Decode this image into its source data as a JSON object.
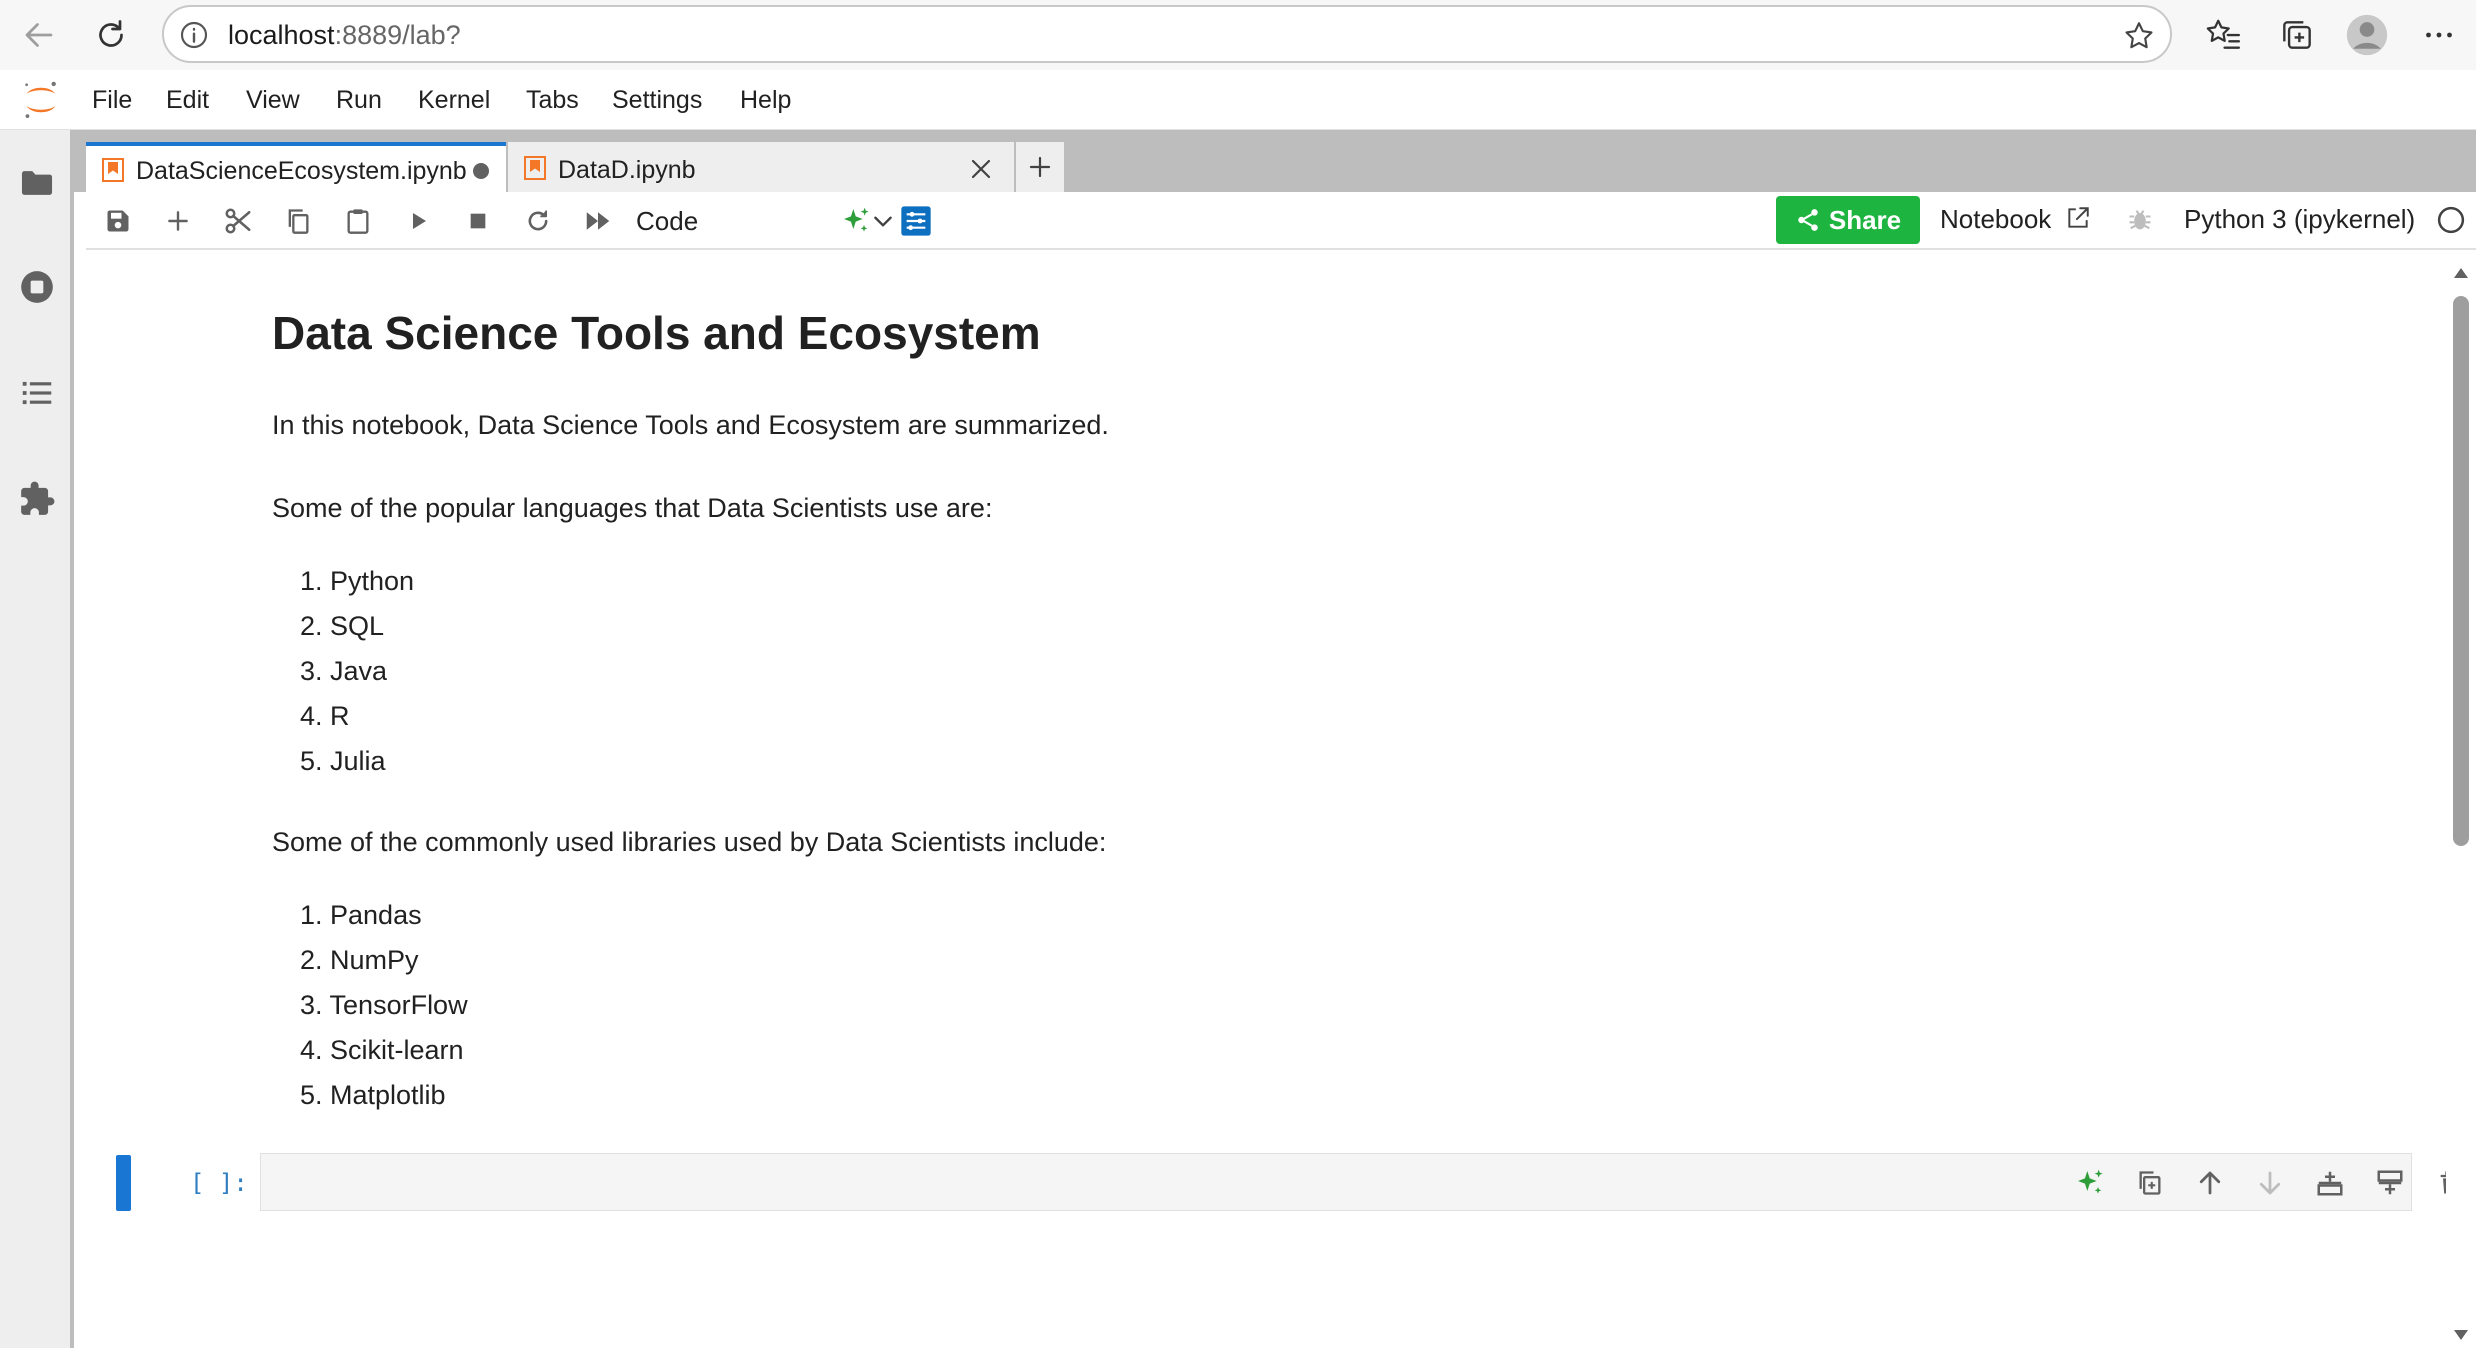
{
  "browser": {
    "url_host": "localhost",
    "url_rest": ":8889/lab?"
  },
  "menubar": {
    "items": [
      "File",
      "Edit",
      "View",
      "Run",
      "Kernel",
      "Tabs",
      "Settings",
      "Help"
    ]
  },
  "tabs": [
    {
      "label": "DataScienceEcosystem.ipynb",
      "state": "unsaved",
      "active": true
    },
    {
      "label": "DataD.ipynb",
      "state": "closable",
      "active": false
    }
  ],
  "tab_add_label": "+",
  "toolbar": {
    "cell_type": "Code",
    "share_label": "Share",
    "notebook_label": "Notebook",
    "kernel_label": "Python 3 (ipykernel)"
  },
  "notebook": {
    "title": "Data Science Tools and Ecosystem",
    "intro": "In this notebook, Data Science Tools and Ecosystem are summarized.",
    "languages_heading": "Some of the popular languages that Data Scientists use are:",
    "languages": [
      "1. Python",
      "2. SQL",
      "3. Java",
      "4. R",
      "5. Julia"
    ],
    "libraries_heading": "Some of the commonly used libraries used by Data Scientists include:",
    "libraries": [
      "1. Pandas",
      "2. NumPy",
      "3. TensorFlow",
      "4. Scikit-learn",
      "5. Matplotlib"
    ],
    "code_prompt": "[ ]:"
  },
  "colors": {
    "accent": "#1976d2",
    "share": "#1db440",
    "jupyter_orange": "#f37726",
    "ai_green": "#2e9e3a"
  }
}
